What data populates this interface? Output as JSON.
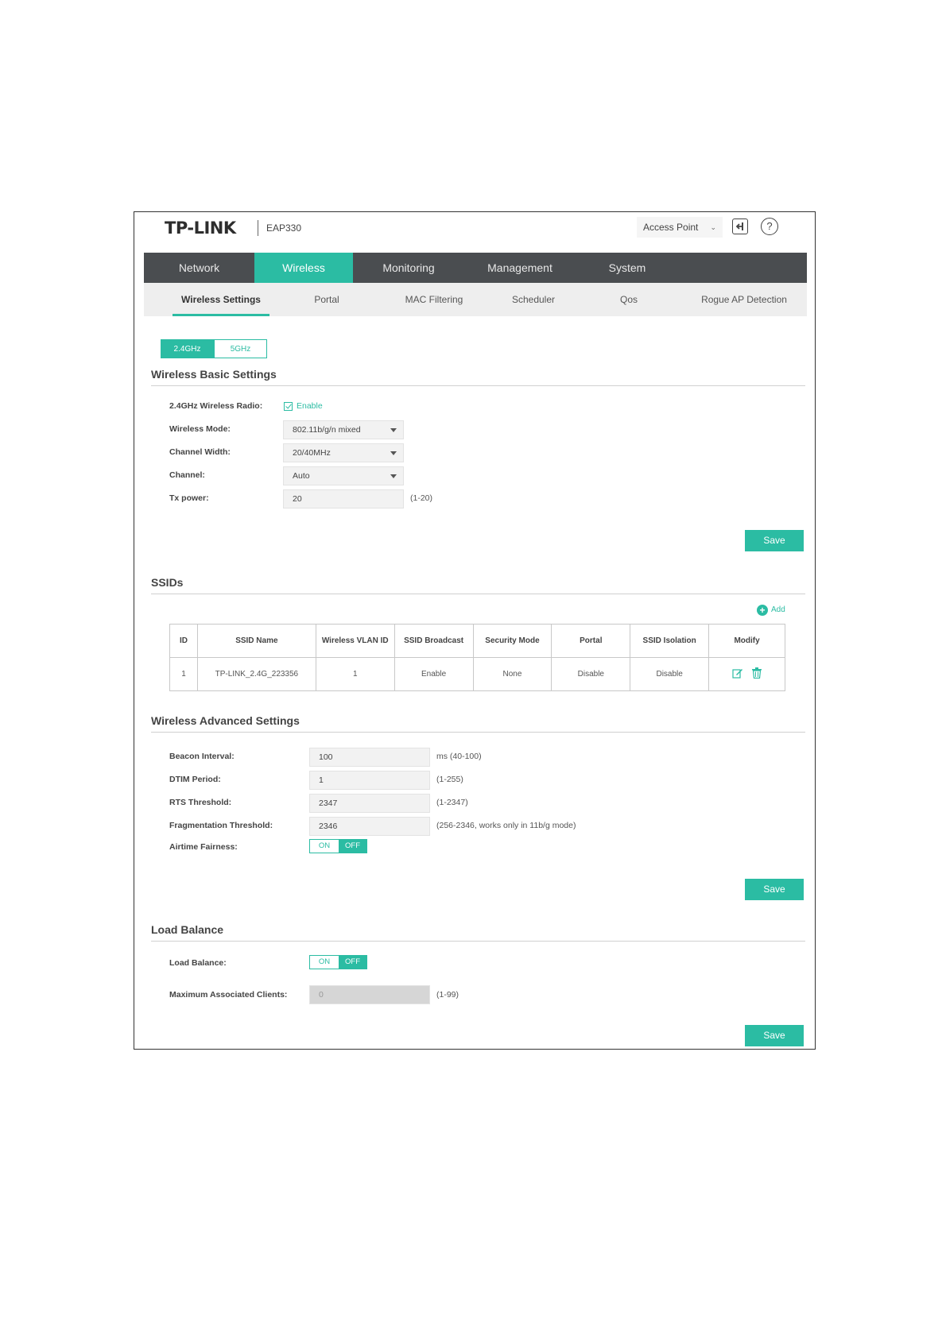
{
  "header": {
    "logo": "TP-LINK",
    "model": "EAP330",
    "mode_select": "Access Point",
    "logout_icon": "logout-icon",
    "help_icon": "help-icon",
    "help_glyph": "?"
  },
  "main_nav": {
    "items": [
      "Network",
      "Wireless",
      "Monitoring",
      "Management",
      "System"
    ],
    "active": "Wireless"
  },
  "sub_nav": {
    "items": [
      "Wireless Settings",
      "Portal",
      "MAC Filtering",
      "Scheduler",
      "Qos",
      "Rogue AP Detection"
    ],
    "active": "Wireless Settings"
  },
  "band_tabs": {
    "items": [
      "2.4GHz",
      "5GHz"
    ],
    "active": "2.4GHz"
  },
  "basic": {
    "title": "Wireless Basic Settings",
    "radio_label": "2.4GHz Wireless Radio:",
    "radio_enable": "Enable",
    "mode_label": "Wireless Mode:",
    "mode_value": "802.11b/g/n mixed",
    "width_label": "Channel Width:",
    "width_value": "20/40MHz",
    "channel_label": "Channel:",
    "channel_value": "Auto",
    "tx_label": "Tx power:",
    "tx_value": "20",
    "tx_hint": "(1-20)",
    "save": "Save"
  },
  "ssids": {
    "title": "SSIDs",
    "add": "Add",
    "columns": [
      "ID",
      "SSID Name",
      "Wireless VLAN ID",
      "SSID Broadcast",
      "Security Mode",
      "Portal",
      "SSID Isolation",
      "Modify"
    ],
    "rows": [
      {
        "id": "1",
        "name": "TP-LINK_2.4G_223356",
        "vlan": "1",
        "broadcast": "Enable",
        "security": "None",
        "portal": "Disable",
        "isolation": "Disable"
      }
    ]
  },
  "advanced": {
    "title": "Wireless Advanced Settings",
    "beacon_label": "Beacon Interval:",
    "beacon_value": "100",
    "beacon_hint": "ms (40-100)",
    "dtim_label": "DTIM Period:",
    "dtim_value": "1",
    "dtim_hint": "(1-255)",
    "rts_label": "RTS Threshold:",
    "rts_value": "2347",
    "rts_hint": "(1-2347)",
    "frag_label": "Fragmentation Threshold:",
    "frag_value": "2346",
    "frag_hint": "(256-2346, works only in 11b/g mode)",
    "airtime_label": "Airtime Fairness:",
    "toggle_on": "ON",
    "toggle_off": "OFF",
    "save": "Save"
  },
  "load_balance": {
    "title": "Load Balance",
    "lb_label": "Load Balance:",
    "toggle_on": "ON",
    "toggle_off": "OFF",
    "max_label": "Maximum Associated Clients:",
    "max_value": "0",
    "max_hint": "(1-99)",
    "save": "Save"
  },
  "colors": {
    "accent": "#2bbca3",
    "nav_bg": "#4a4d50",
    "subnav_bg": "#eeeeee"
  }
}
